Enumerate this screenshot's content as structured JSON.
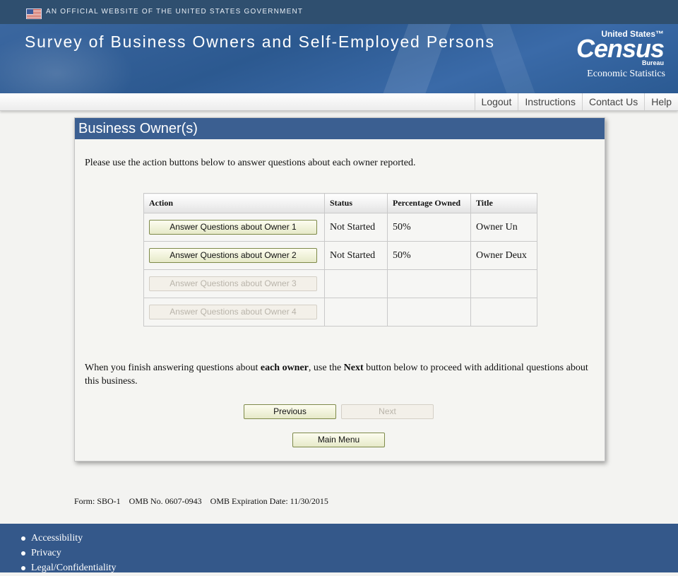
{
  "gov_banner": {
    "text": "AN OFFICIAL WEBSITE OF THE UNITED STATES GOVERNMENT"
  },
  "header": {
    "title": "Survey of Business Owners and Self-Employed Persons",
    "logo": {
      "line1": "United States™",
      "line2": "Census",
      "line3": "Bureau",
      "line4": "Economic Statistics"
    }
  },
  "nav": {
    "items": [
      "Logout",
      "Instructions",
      "Contact Us",
      "Help"
    ]
  },
  "panel": {
    "title": "Business Owner(s)",
    "intro": "Please use the action buttons below to answer questions about each owner reported.",
    "table": {
      "headers": [
        "Action",
        "Status",
        "Percentage Owned",
        "Title"
      ],
      "rows": [
        {
          "action": "Answer Questions about Owner 1",
          "status": "Not Started",
          "percent": "50%",
          "title": "Owner Un",
          "enabled": true
        },
        {
          "action": "Answer Questions about Owner 2",
          "status": "Not Started",
          "percent": "50%",
          "title": "Owner Deux",
          "enabled": true
        },
        {
          "action": "Answer Questions about Owner 3",
          "status": "",
          "percent": "",
          "title": "",
          "enabled": false
        },
        {
          "action": "Answer Questions about Owner 4",
          "status": "",
          "percent": "",
          "title": "",
          "enabled": false
        }
      ]
    },
    "finish": {
      "part1": "When you finish answering questions about ",
      "bold1": "each owner",
      "part2": ", use the ",
      "bold2": "Next",
      "part3": " button below to proceed with additional questions about this business."
    },
    "buttons": {
      "previous": "Previous",
      "next": "Next",
      "main_menu": "Main Menu"
    }
  },
  "form_info": "Form: SBO-1    OMB No. 0607-0943    OMB Expiration Date: 11/30/2015",
  "footer": {
    "links": [
      "Accessibility",
      "Privacy",
      "Legal/Confidentiality"
    ]
  }
}
